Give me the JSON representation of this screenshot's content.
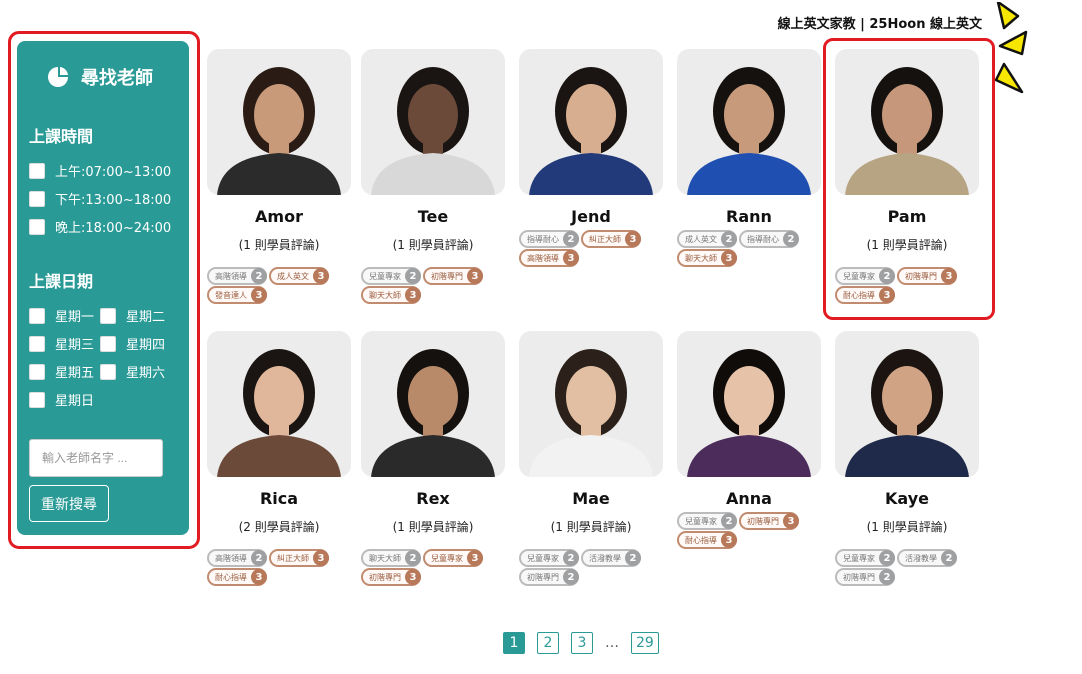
{
  "brand": "線上英文家教 | 25Hoon 線上英文",
  "sidebar": {
    "title": "尋找老師",
    "icon": "pie-chart-icon",
    "time_heading": "上課時間",
    "times": [
      "上午:07:00~13:00",
      "下午:13:00~18:00",
      "晚上:18:00~24:00"
    ],
    "date_heading": "上課日期",
    "days": [
      "星期一",
      "星期二",
      "星期三",
      "星期四",
      "星期五",
      "星期六",
      "星期日"
    ],
    "search_placeholder": "輸入老師名字 ...",
    "reset_label": "重新搜尋"
  },
  "teachers": [
    {
      "name": "Amor",
      "reviews": "(1 則學員評論)",
      "badges": [
        {
          "label": "高階領導",
          "level": "2",
          "tier": "silver"
        },
        {
          "label": "成人英文",
          "level": "3",
          "tier": "bronze"
        },
        {
          "label": "發音達人",
          "level": "3",
          "tier": "bronze"
        }
      ]
    },
    {
      "name": "Tee",
      "reviews": "(1 則學員評論)",
      "badges": [
        {
          "label": "兒童專家",
          "level": "2",
          "tier": "silver"
        },
        {
          "label": "初階專門",
          "level": "3",
          "tier": "bronze"
        },
        {
          "label": "聊天大師",
          "level": "3",
          "tier": "bronze"
        }
      ]
    },
    {
      "name": "Jend",
      "reviews": "",
      "badges": [
        {
          "label": "指導耐心",
          "level": "2",
          "tier": "silver"
        },
        {
          "label": "糾正大師",
          "level": "3",
          "tier": "bronze"
        },
        {
          "label": "高階領導",
          "level": "3",
          "tier": "bronze"
        }
      ]
    },
    {
      "name": "Rann",
      "reviews": "",
      "badges": [
        {
          "label": "成人英文",
          "level": "2",
          "tier": "silver"
        },
        {
          "label": "指導耐心",
          "level": "2",
          "tier": "silver"
        },
        {
          "label": "聊天大師",
          "level": "3",
          "tier": "bronze"
        }
      ]
    },
    {
      "name": "Pam",
      "reviews": "(1 則學員評論)",
      "badges": [
        {
          "label": "兒童專家",
          "level": "2",
          "tier": "silver"
        },
        {
          "label": "初階專門",
          "level": "3",
          "tier": "bronze"
        },
        {
          "label": "耐心指導",
          "level": "3",
          "tier": "bronze"
        }
      ]
    },
    {
      "name": "Rica",
      "reviews": "(2 則學員評論)",
      "badges": [
        {
          "label": "高階領導",
          "level": "2",
          "tier": "silver"
        },
        {
          "label": "糾正大師",
          "level": "3",
          "tier": "bronze"
        },
        {
          "label": "耐心指導",
          "level": "3",
          "tier": "bronze"
        }
      ]
    },
    {
      "name": "Rex",
      "reviews": "(1 則學員評論)",
      "badges": [
        {
          "label": "聊天大師",
          "level": "2",
          "tier": "silver"
        },
        {
          "label": "兒童專家",
          "level": "3",
          "tier": "bronze"
        },
        {
          "label": "初階專門",
          "level": "3",
          "tier": "bronze"
        }
      ]
    },
    {
      "name": "Mae",
      "reviews": "(1 則學員評論)",
      "badges": [
        {
          "label": "兒童專家",
          "level": "2",
          "tier": "silver"
        },
        {
          "label": "活潑教學",
          "level": "2",
          "tier": "silver"
        },
        {
          "label": "初階專門",
          "level": "2",
          "tier": "silver"
        }
      ]
    },
    {
      "name": "Anna",
      "reviews": "",
      "badges": [
        {
          "label": "兒童專家",
          "level": "2",
          "tier": "silver"
        },
        {
          "label": "初階專門",
          "level": "3",
          "tier": "bronze"
        },
        {
          "label": "耐心指導",
          "level": "3",
          "tier": "bronze"
        }
      ]
    },
    {
      "name": "Kaye",
      "reviews": "(1 則學員評論)",
      "badges": [
        {
          "label": "兒童專家",
          "level": "2",
          "tier": "silver"
        },
        {
          "label": "活潑教學",
          "level": "2",
          "tier": "silver"
        },
        {
          "label": "初階專門",
          "level": "2",
          "tier": "silver"
        }
      ]
    }
  ],
  "pagination": {
    "pages": [
      "1",
      "2",
      "3",
      "29"
    ],
    "ellipsis": "…",
    "current": "1"
  },
  "colors": {
    "accent": "#2a9a96",
    "highlight": "#e21b23",
    "bronze": "#b8785a",
    "silver": "#9ea0a2"
  }
}
